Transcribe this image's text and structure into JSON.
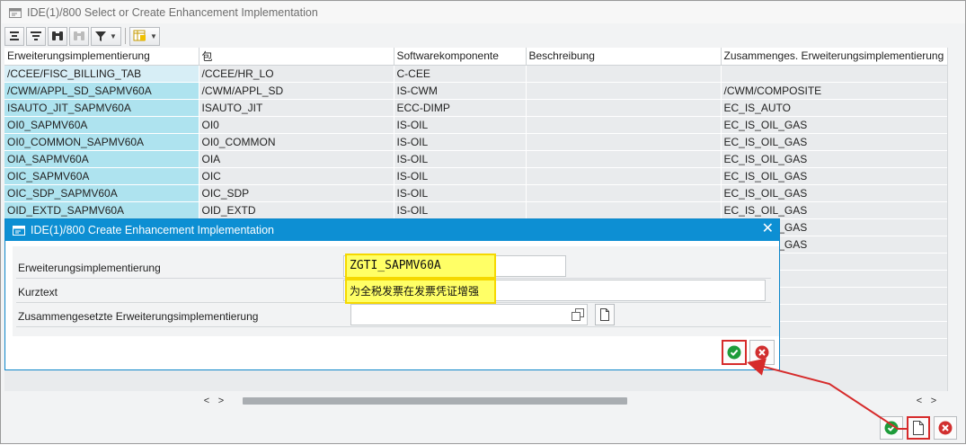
{
  "window": {
    "title": "IDE(1)/800 Select or Create Enhancement Implementation"
  },
  "toolbar": {
    "buttons": [
      "sort-ascending-icon",
      "filter-lines-icon",
      "binoculars-find-icon",
      "binoculars-find-next-icon",
      "filter-icon",
      "layout-icon"
    ]
  },
  "table": {
    "columns": [
      "Erweiterungsimplementierung",
      "包",
      "Softwarekomponente",
      "Beschreibung",
      "Zusammenges. Erweiterungsimplementierung"
    ],
    "rows": [
      [
        "/CCEE/FISC_BILLING_TAB",
        "/CCEE/HR_LO",
        "C-CEE",
        "",
        ""
      ],
      [
        "/CWM/APPL_SD_SAPMV60A",
        "/CWM/APPL_SD",
        "IS-CWM",
        "",
        "/CWM/COMPOSITE"
      ],
      [
        "ISAUTO_JIT_SAPMV60A",
        "ISAUTO_JIT",
        "ECC-DIMP",
        "",
        "EC_IS_AUTO"
      ],
      [
        "OI0_SAPMV60A",
        "OI0",
        "IS-OIL",
        "",
        "EC_IS_OIL_GAS"
      ],
      [
        "OI0_COMMON_SAPMV60A",
        "OI0_COMMON",
        "IS-OIL",
        "",
        "EC_IS_OIL_GAS"
      ],
      [
        "OIA_SAPMV60A",
        "OIA",
        "IS-OIL",
        "",
        "EC_IS_OIL_GAS"
      ],
      [
        "OIC_SAPMV60A",
        "OIC",
        "IS-OIL",
        "",
        "EC_IS_OIL_GAS"
      ],
      [
        "OIC_SDP_SAPMV60A",
        "OIC_SDP",
        "IS-OIL",
        "",
        "EC_IS_OIL_GAS"
      ],
      [
        "OID_EXTD_SAPMV60A",
        "OID_EXTD",
        "IS-OIL",
        "",
        "EC_IS_OIL_GAS"
      ],
      [
        "",
        "",
        "",
        "",
        "EC_IS_OIL_GAS"
      ],
      [
        "",
        "",
        "",
        "",
        "EC_IS_OIL_GAS"
      ]
    ]
  },
  "dialog": {
    "title": "IDE(1)/800 Create Enhancement Implementation",
    "fields": {
      "impl_label": "Erweiterungsimplementierung",
      "impl_value": "ZGTI_SAPMV60A",
      "short_label": "Kurztext",
      "short_value": "为全税发票在发票凭证增强",
      "composite_label": "Zusammengesetzte Erweiterungsimplementierung",
      "composite_value": ""
    }
  },
  "colors": {
    "dialog_title_bar": "#0d8fd3",
    "key_column": "#aee3ef",
    "field_highlight": "#ffff66",
    "annotation_red": "#d62b2b",
    "confirm_green": "#1e9c3a"
  }
}
